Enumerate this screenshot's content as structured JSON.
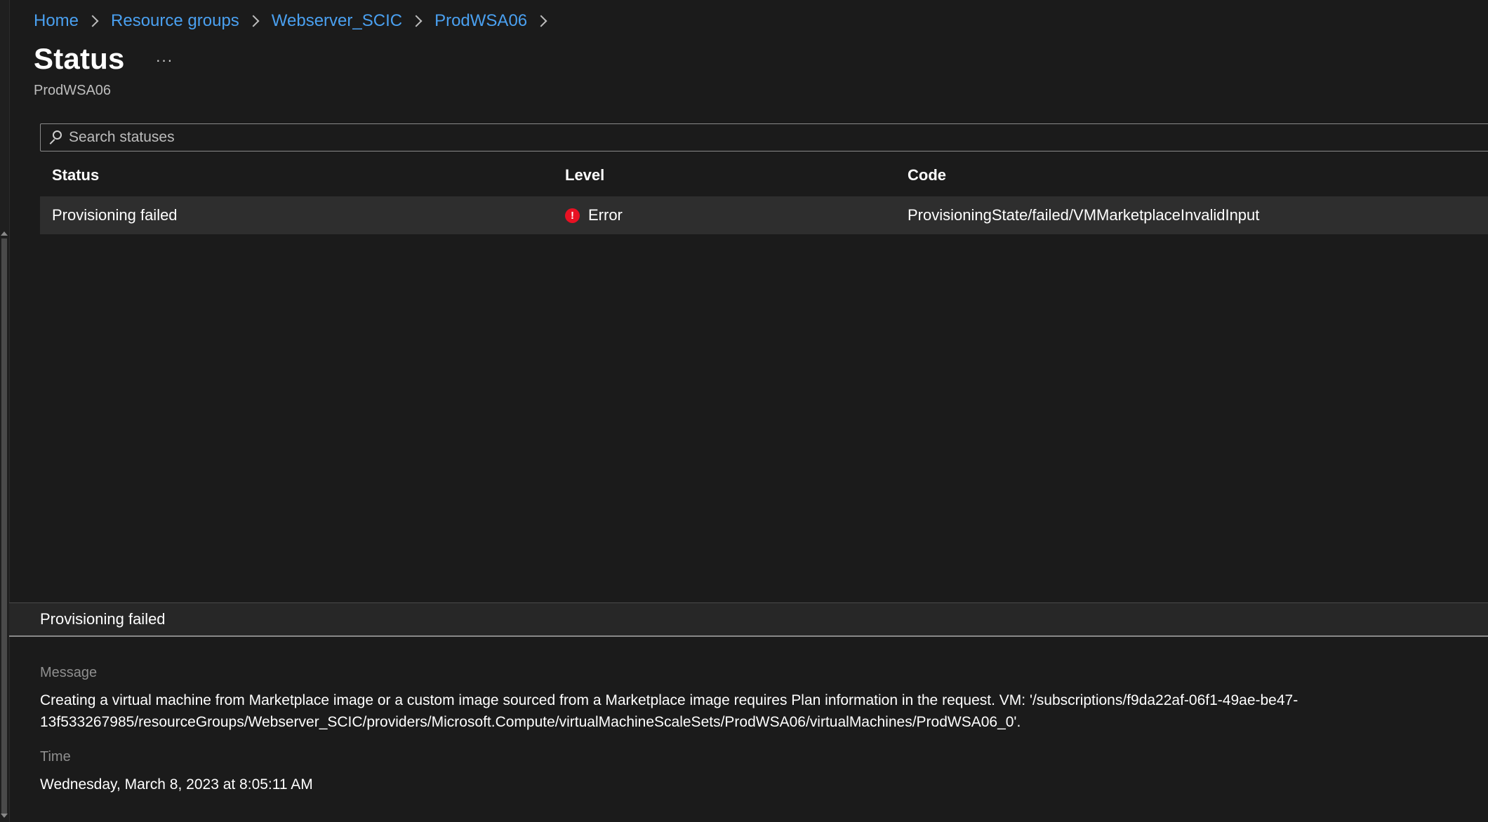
{
  "breadcrumb": {
    "items": [
      {
        "label": "Home"
      },
      {
        "label": "Resource groups"
      },
      {
        "label": "Webserver_SCIC"
      },
      {
        "label": "ProdWSA06"
      }
    ]
  },
  "header": {
    "title": "Status",
    "more_label": "···",
    "subtitle": "ProdWSA06"
  },
  "search": {
    "placeholder": "Search statuses",
    "value": ""
  },
  "table": {
    "columns": [
      "Status",
      "Level",
      "Code"
    ],
    "rows": [
      {
        "status": "Provisioning failed",
        "level": "Error",
        "level_icon": "error-icon",
        "code": "ProvisioningState/failed/VMMarketplaceInvalidInput"
      }
    ]
  },
  "details": {
    "header": "Provisioning failed",
    "message_label": "Message",
    "message_line1": "Creating a virtual machine from Marketplace image or a custom image sourced from a Marketplace image requires Plan information in the request. VM: '/subscriptions/f9da22af-06f1-49ae-be47-",
    "message_line2": "13f533267985/resourceGroups/Webserver_SCIC/providers/Microsoft.Compute/virtualMachineScaleSets/ProdWSA06/virtualMachines/ProdWSA06_0'.",
    "time_label": "Time",
    "time_value": "Wednesday, March 8, 2023 at 8:05:11 AM"
  },
  "colors": {
    "background": "#1b1b1b",
    "link": "#4aa0f0",
    "error": "#e81123",
    "row_selected": "#2e2e2e"
  }
}
